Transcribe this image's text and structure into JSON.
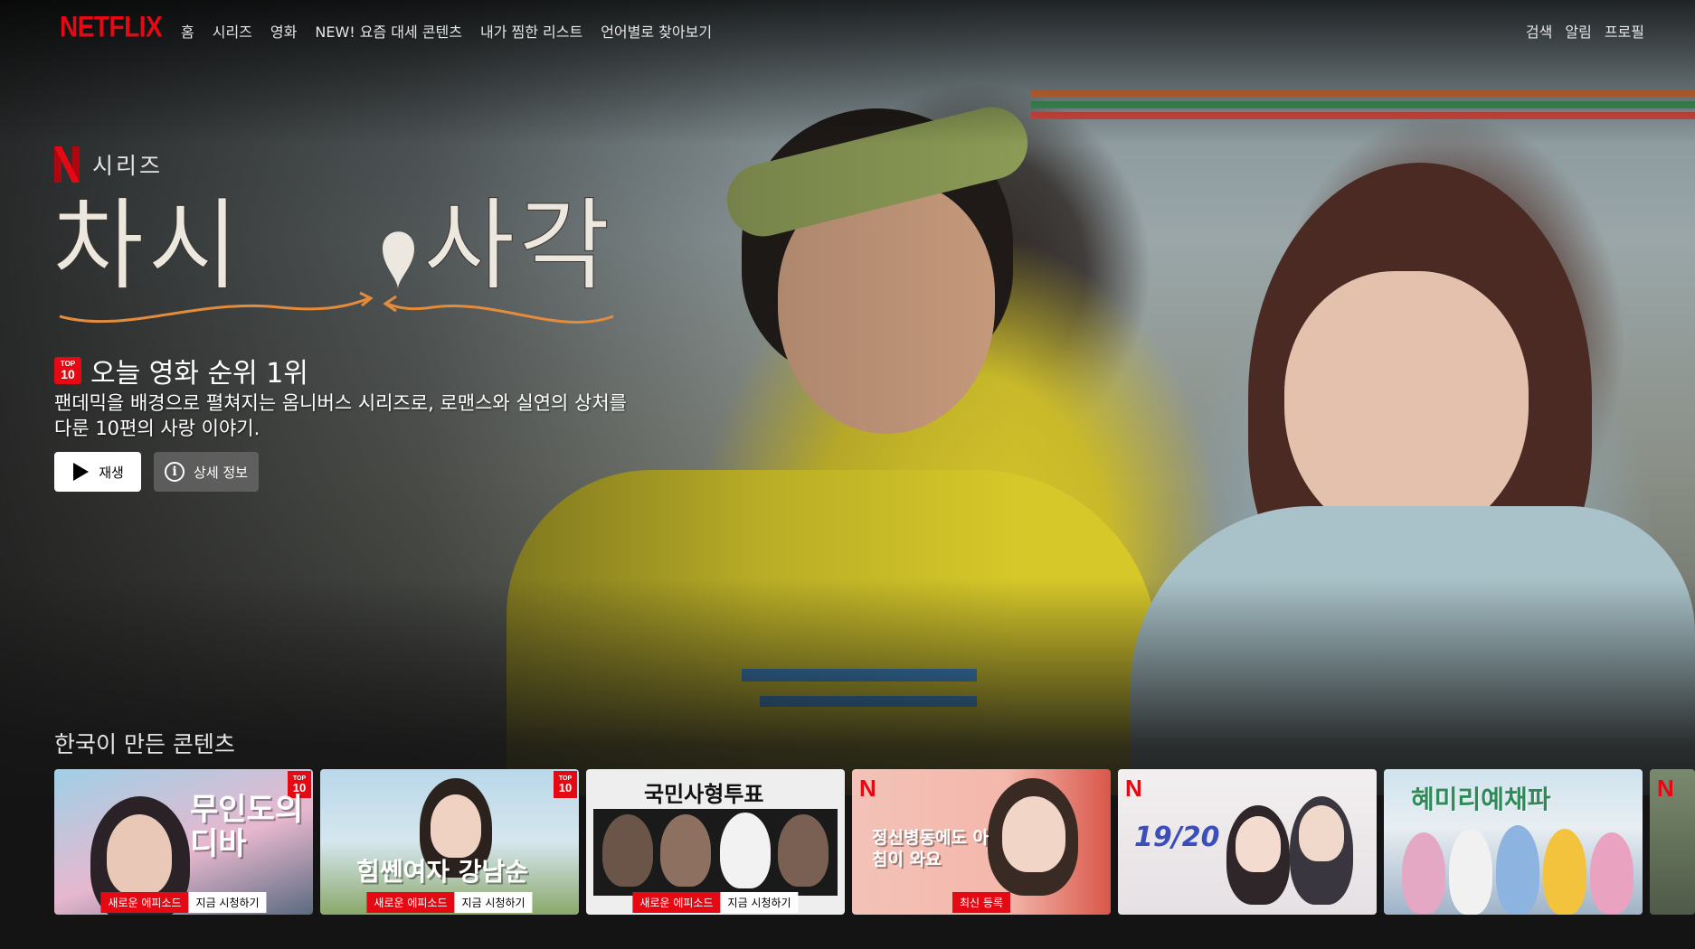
{
  "nav": {
    "logo": "NETFLIX",
    "links": [
      "홈",
      "시리즈",
      "영화",
      "NEW! 요즘 대세 콘텐츠",
      "내가 찜한 리스트",
      "언어별로 찾아보기"
    ],
    "right": {
      "search": "검색",
      "notifications": "알림",
      "profile": "프로필"
    }
  },
  "hero": {
    "type_label": "시리즈",
    "title": "차시 ♡ 사각",
    "top10_badge": {
      "line1": "TOP",
      "line2": "10"
    },
    "rank_text": "오늘 영화 순위 1위",
    "synopsis_line1": "팬데믹을 배경으로 펼쳐지는 옴니버스 시리즈로, 로맨스와 실연의 상처를",
    "synopsis_line2": "다룬 10편의 사랑 이야기.",
    "play_label": "재생",
    "info_label": "상세 정보"
  },
  "row": {
    "title": "한국이 만든 콘텐츠",
    "cards": [
      {
        "title": "무인도의 디바",
        "top10": true,
        "badge_red": "새로운 에피소드",
        "badge_white": "지금 시청하기"
      },
      {
        "title": "힘쎈여자 강남순",
        "top10": true,
        "badge_red": "새로운 에피소드",
        "badge_white": "지금 시청하기"
      },
      {
        "title": "국민사형투표",
        "top10": false,
        "badge_red": "새로운 에피소드",
        "badge_white": "지금 시청하기"
      },
      {
        "title": "정신병동에도 아침이 와요",
        "top10": false,
        "badge_red": "최신 등록",
        "badge_white": ""
      },
      {
        "title": "19/20",
        "top10": false,
        "badge_red": "",
        "badge_white": ""
      },
      {
        "title": "혜미리예채파",
        "top10": false,
        "badge_red": "",
        "badge_white": ""
      }
    ]
  },
  "colors": {
    "brand_red": "#e50914",
    "background": "#141414"
  },
  "icons": [
    "play-icon",
    "info-icon",
    "netflix-n-icon",
    "top10-icon"
  ]
}
